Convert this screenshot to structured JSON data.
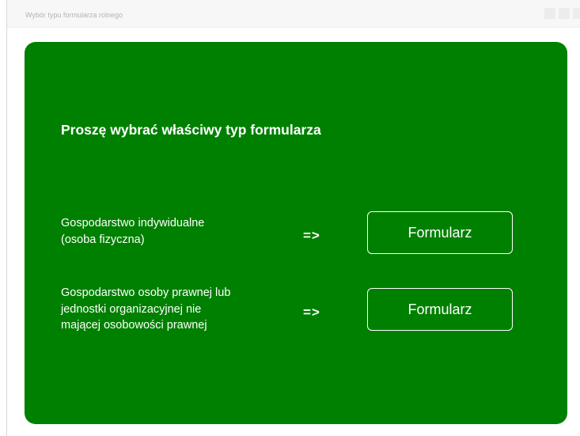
{
  "window": {
    "title": "Wybór typu formularza rolnego"
  },
  "panel": {
    "heading": "Proszę wybrać właściwy typ formularza",
    "background_color": "#008000",
    "rows": [
      {
        "label_lines": [
          "Gospodarstwo indywidualne",
          "(osoba fizyczna)"
        ],
        "arrow": "=>",
        "button_label": "Formularz"
      },
      {
        "label_lines": [
          "Gospodarstwo osoby prawnej lub",
          "jednostki organizacyjnej nie",
          "mającej osobowości prawnej"
        ],
        "arrow": "=>",
        "button_label": "Formularz"
      }
    ]
  }
}
